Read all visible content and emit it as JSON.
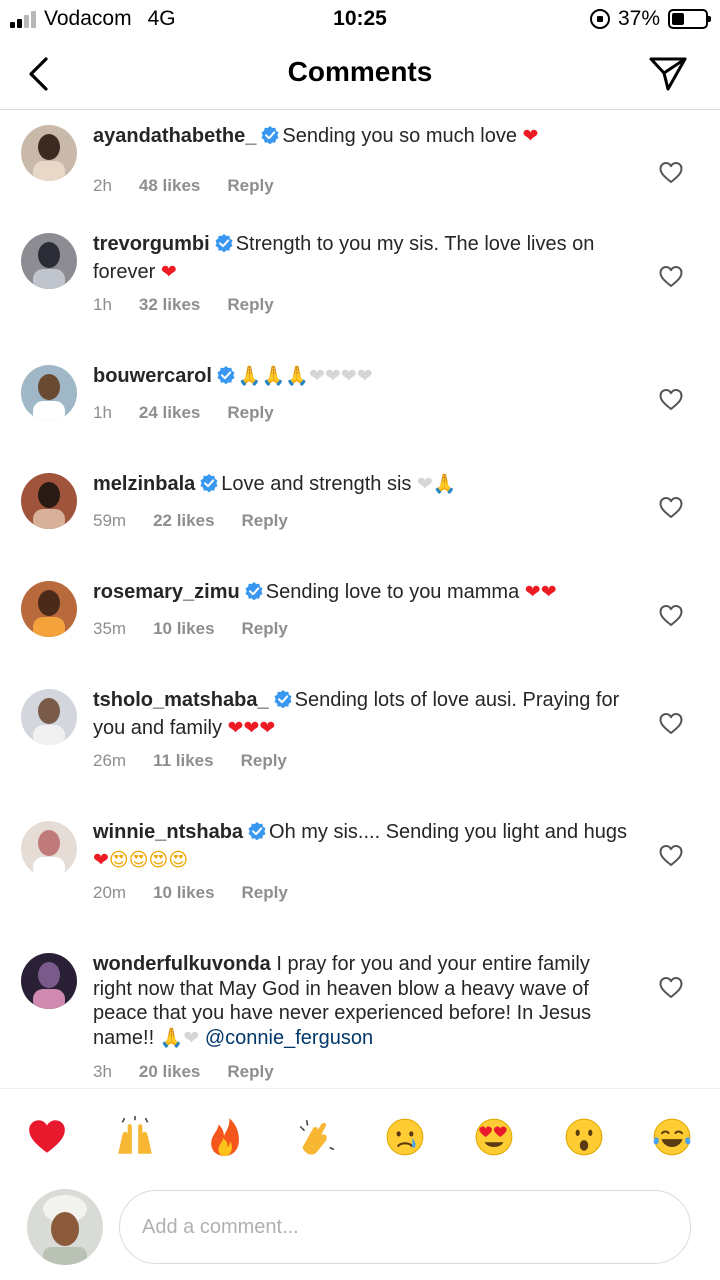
{
  "status_bar": {
    "carrier": "Vodacom",
    "network": "4G",
    "time": "10:25",
    "battery_percent": "37%",
    "battery_level": 0.37,
    "signal_bars": 2
  },
  "header": {
    "title": "Comments"
  },
  "comments": [
    {
      "username": "ayandathabethe_",
      "verified": true,
      "text": "Sending you so much love",
      "emojis": [
        {
          "char": "❤",
          "color": "red"
        }
      ],
      "time": "2h",
      "likes": "48 likes",
      "reply": "Reply"
    },
    {
      "username": "trevorgumbi",
      "verified": true,
      "text": "Strength to you my sis. The love lives on forever",
      "emojis": [
        {
          "char": "❤",
          "color": "red"
        }
      ],
      "time": "1h",
      "likes": "32 likes",
      "reply": "Reply"
    },
    {
      "username": "bouwercarol",
      "verified": true,
      "text": "",
      "emojis": [
        {
          "char": "🙏",
          "color": "brown"
        },
        {
          "char": "🙏",
          "color": "brown"
        },
        {
          "char": "🙏",
          "color": "brown"
        },
        {
          "char": "❤",
          "color": "white"
        },
        {
          "char": "❤",
          "color": "white"
        },
        {
          "char": "❤",
          "color": "white"
        },
        {
          "char": "❤",
          "color": "white"
        }
      ],
      "time": "1h",
      "likes": "24 likes",
      "reply": "Reply"
    },
    {
      "username": "melzinbala",
      "verified": true,
      "text": "Love and strength sis",
      "emojis": [
        {
          "char": "❤",
          "color": "white"
        },
        {
          "char": "🙏",
          "color": "brown"
        }
      ],
      "time": "59m",
      "likes": "22 likes",
      "reply": "Reply"
    },
    {
      "username": "rosemary_zimu",
      "verified": true,
      "text": "Sending love to you mamma",
      "emojis": [
        {
          "char": "❤",
          "color": "red"
        },
        {
          "char": "❤",
          "color": "red"
        }
      ],
      "time": "35m",
      "likes": "10 likes",
      "reply": "Reply"
    },
    {
      "username": "tsholo_matshaba_",
      "verified": true,
      "text": "Sending lots of love ausi. Praying for you and family",
      "emojis": [
        {
          "char": "❤",
          "color": "red"
        },
        {
          "char": "❤",
          "color": "red"
        },
        {
          "char": "❤",
          "color": "red"
        }
      ],
      "time": "26m",
      "likes": "11 likes",
      "reply": "Reply"
    },
    {
      "username": "winnie_ntshaba",
      "verified": true,
      "text": "Oh my sis.... Sending you light and hugs",
      "emojis": [
        {
          "char": "❤",
          "color": "red"
        },
        {
          "char": "😍",
          "color": "yellow"
        },
        {
          "char": "😍",
          "color": "yellow"
        },
        {
          "char": "😍",
          "color": "yellow"
        },
        {
          "char": "😍",
          "color": "yellow"
        }
      ],
      "time": "20m",
      "likes": "10 likes",
      "reply": "Reply"
    },
    {
      "username": "wonderfulkuvonda",
      "verified": false,
      "text": "I pray for you and your entire family right now that May God in heaven blow a heavy wave of peace that you have never experienced before! In Jesus name!!",
      "emojis": [
        {
          "char": "🙏",
          "color": "brown"
        },
        {
          "char": "❤",
          "color": "white"
        }
      ],
      "mention": "@connie_ferguson",
      "time": "3h",
      "likes": "20 likes",
      "reply": "Reply"
    }
  ],
  "reactions": [
    {
      "icon": "red-heart-emoji"
    },
    {
      "icon": "raising-hands-emoji"
    },
    {
      "icon": "fire-emoji"
    },
    {
      "icon": "clapping-hands-emoji"
    },
    {
      "icon": "crying-face-emoji"
    },
    {
      "icon": "heart-eyes-emoji"
    },
    {
      "icon": "surprised-face-emoji"
    },
    {
      "icon": "tears-of-joy-emoji"
    }
  ],
  "composer": {
    "placeholder": "Add a comment..."
  },
  "colors": {
    "text": "#262626",
    "meta": "#8e8e8e",
    "verified": "#3897f0",
    "mention": "#00376b",
    "divider": "#dbdbdb"
  }
}
